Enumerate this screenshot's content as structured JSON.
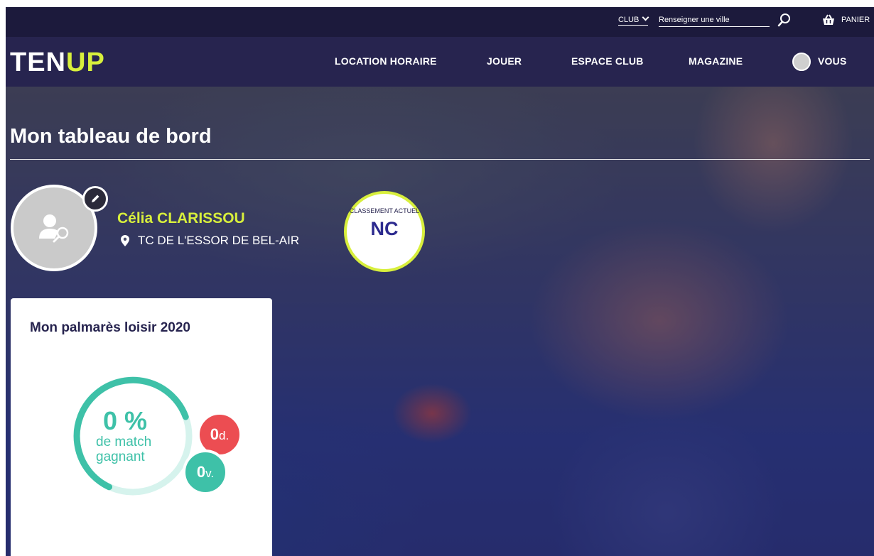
{
  "topbar": {
    "club_label": "CLUB",
    "city_placeholder": "Renseigner une ville",
    "cart_label": "PANIER"
  },
  "nav": {
    "logo_ten": "TEN",
    "logo_up": "UP",
    "items": [
      "LOCATION HORAIRE",
      "JOUER",
      "ESPACE CLUB",
      "MAGAZINE"
    ],
    "user_label": "VOUS"
  },
  "dashboard": {
    "title": "Mon tableau de bord",
    "player_name": "Célia CLARISSOU",
    "club_name": "TC DE L'ESSOR DE BEL-AIR",
    "ranking_label": "CLASSEMENT ACTUEL",
    "ranking_value": "NC"
  },
  "stats": {
    "title": "Mon palmarès loisir 2020",
    "win_percent": "0 %",
    "win_caption": "de match gagnant",
    "defeats_value": "0",
    "defeats_unit": "d.",
    "victories_value": "0",
    "victories_unit": "v."
  },
  "colors": {
    "navy": "#27244f",
    "accent_yellow": "#d8ef3c",
    "teal": "#3ec1a8",
    "red": "#ec4d52"
  }
}
